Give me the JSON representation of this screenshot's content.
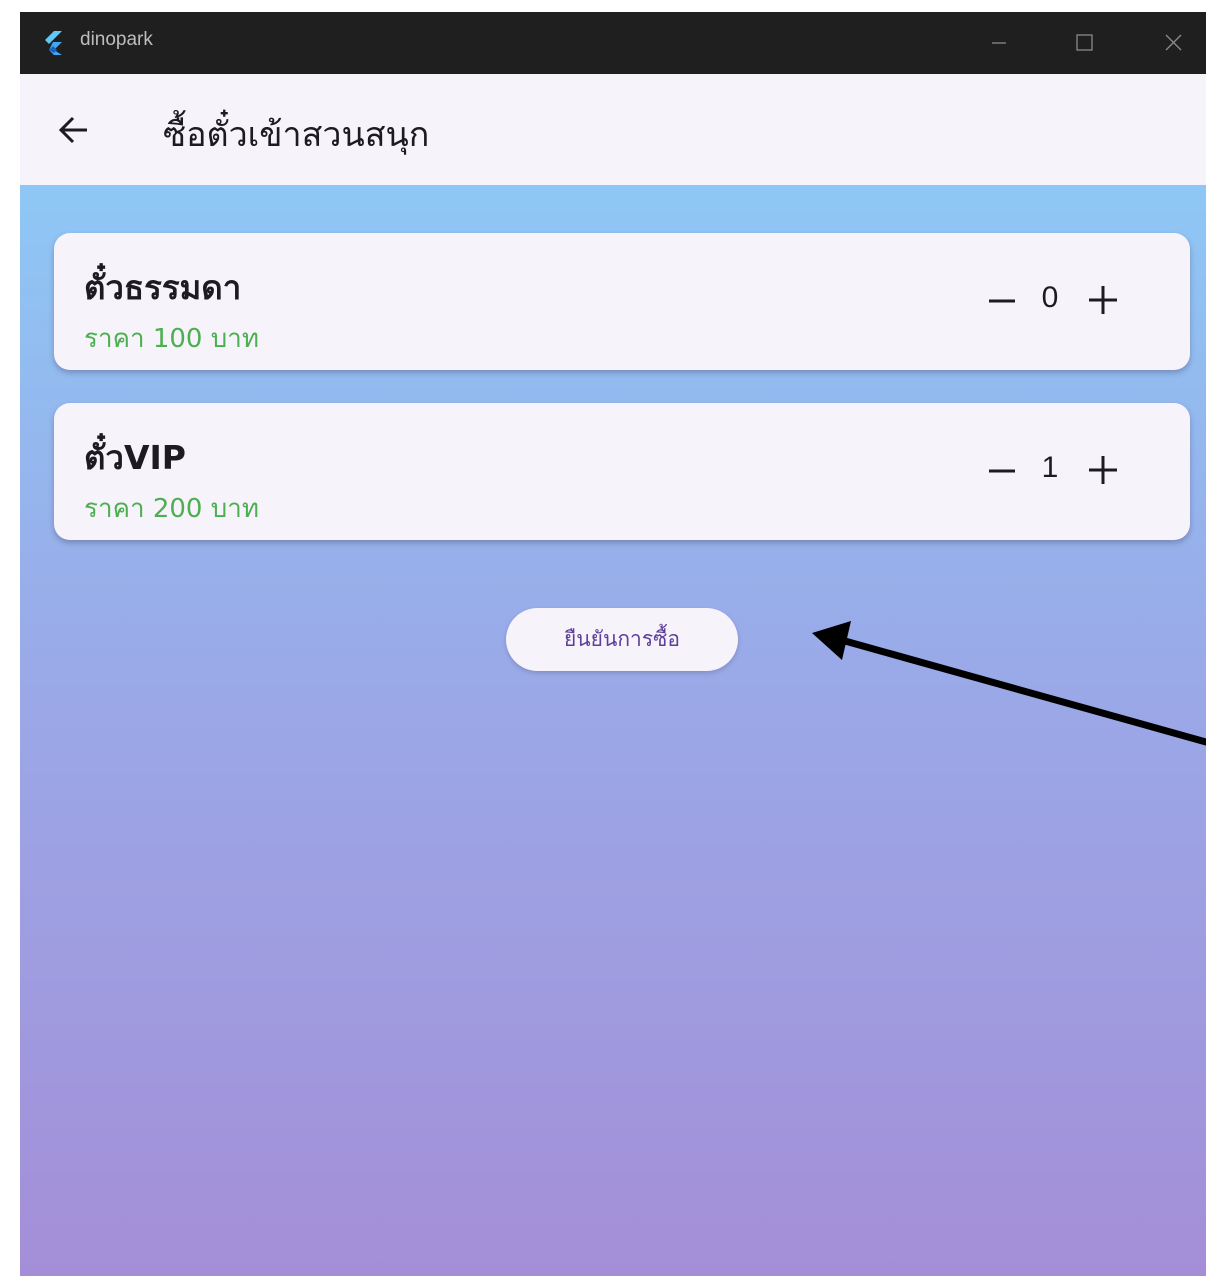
{
  "window": {
    "title": "dinopark"
  },
  "appbar": {
    "title": "ซื้อตั๋วเข้าสวนสนุก"
  },
  "tickets": [
    {
      "name": "ตั๋วธรรมดา",
      "price": "ราคา 100 บาท",
      "quantity": "0"
    },
    {
      "name": "ตั๋วVIP",
      "price": "ราคา 200 บาท",
      "quantity": "1"
    }
  ],
  "actions": {
    "confirm_label": "ยืนยันการซื้อ"
  },
  "icons": {
    "app": "flutter-logo-icon",
    "back": "arrow-back-icon",
    "minimize": "minimize-icon",
    "maximize": "maximize-icon",
    "close": "close-icon",
    "decrement": "minus-icon",
    "increment": "plus-icon",
    "annotation": "annotation-arrow-icon"
  },
  "colors": {
    "price": "#4caf50",
    "button_text": "#5d3f9a",
    "gradient_top": "#8ec7f5",
    "gradient_bottom": "#a48ed8",
    "titlebar": "#1f1f1f"
  }
}
